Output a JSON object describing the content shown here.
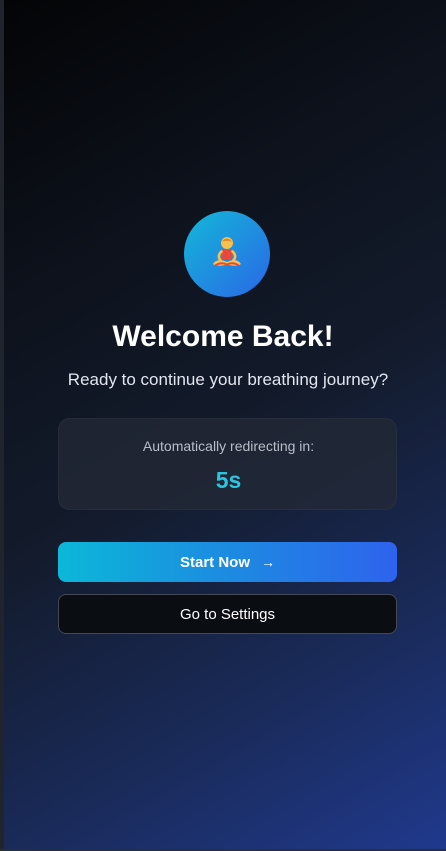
{
  "welcome": {
    "icon": "person-in-lotus-position-icon",
    "title": "Welcome Back!",
    "subtitle": "Ready to continue your breathing journey?"
  },
  "countdown": {
    "label": "Automatically redirecting in:",
    "value": "5s"
  },
  "actions": {
    "start_label": "Start Now",
    "start_icon": "arrow-right-icon",
    "settings_label": "Go to Settings"
  },
  "colors": {
    "accent_cyan": "#0bb8d9",
    "accent_blue": "#2e63ed",
    "countdown_value": "#2ec4df"
  }
}
